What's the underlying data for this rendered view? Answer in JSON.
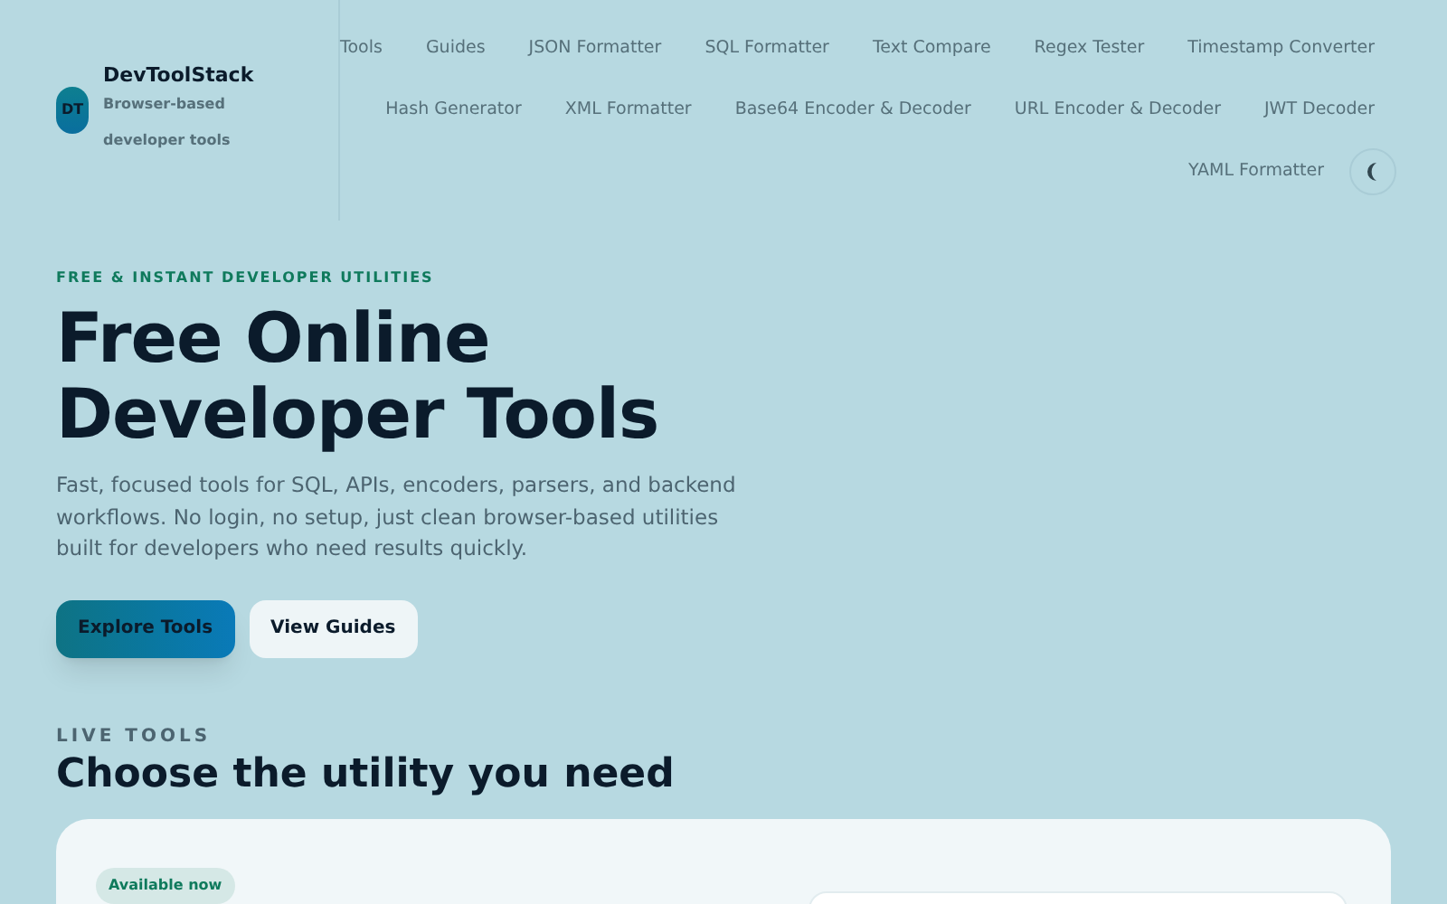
{
  "brand": {
    "badge": "DT",
    "name": "DevToolStack",
    "tagline": "Browser-based developer tools"
  },
  "nav_rows": [
    [
      "Tools",
      "Guides",
      "JSON Formatter",
      "SQL Formatter",
      "Text Compare",
      "Regex Tester",
      "Timestamp Converter"
    ],
    [
      "Hash Generator",
      "XML Formatter",
      "Base64 Encoder & Decoder",
      "URL Encoder & Decoder",
      "JWT Decoder"
    ],
    [
      "YAML Formatter"
    ]
  ],
  "hero": {
    "eyebrow": "FREE & INSTANT DEVELOPER UTILITIES",
    "title": "Free Online Developer Tools",
    "description": "Fast, focused tools for SQL, APIs, encoders, parsers, and backend workflows. No login, no setup, just clean browser-based utilities built for developers who need results quickly.",
    "buttons": [
      {
        "label": "Explore Tools",
        "kind": "primary"
      },
      {
        "label": "View Guides",
        "kind": "secondary"
      }
    ]
  },
  "tools_section": {
    "eyebrow": "LIVE TOOLS",
    "heading": "Choose the utility you need",
    "badge": "Available now"
  }
}
